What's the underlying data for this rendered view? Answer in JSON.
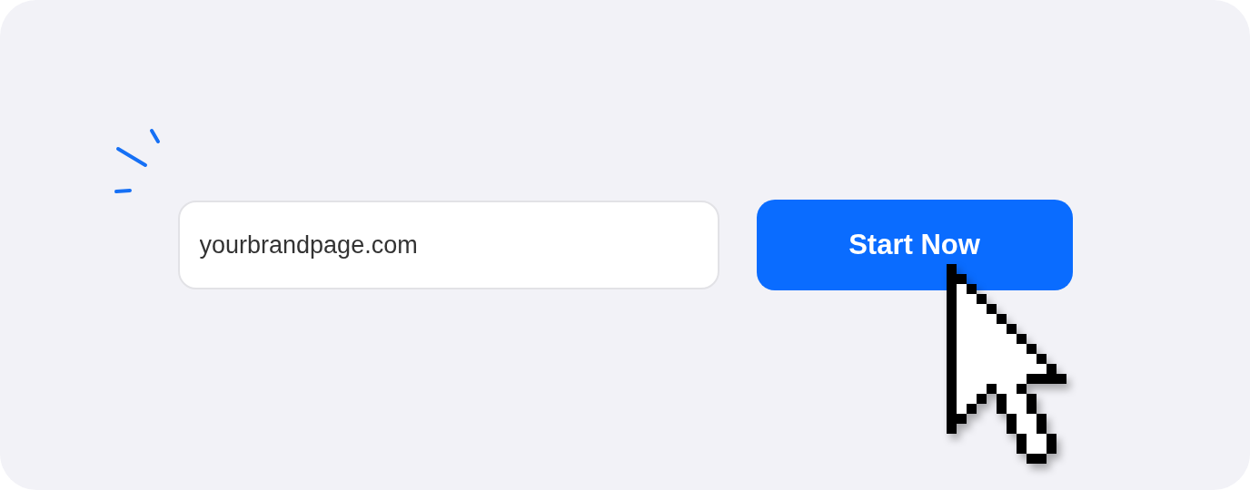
{
  "url_field": {
    "value": "yourbrandpage.com"
  },
  "start_button": {
    "label": "Start Now"
  }
}
